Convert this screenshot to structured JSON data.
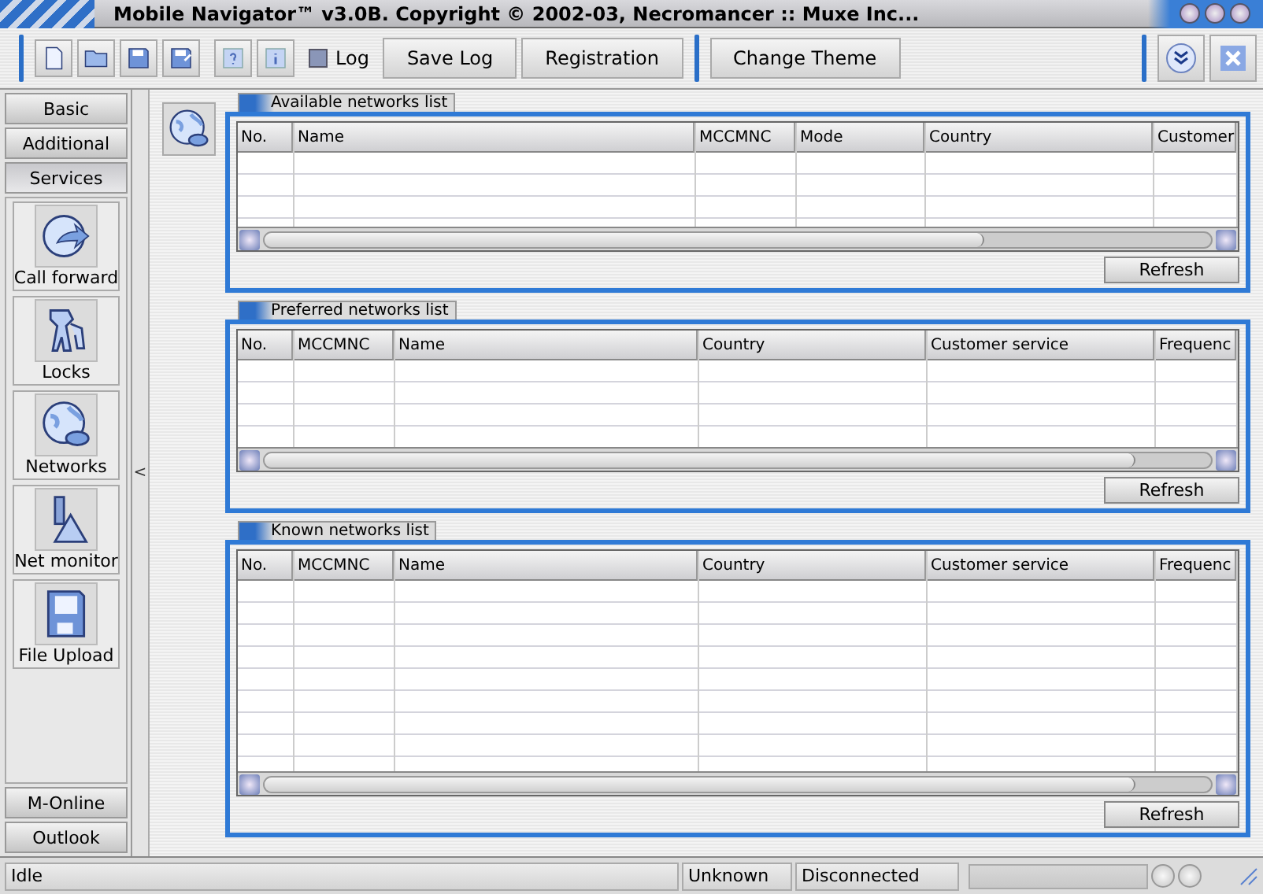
{
  "window": {
    "title": "Mobile Navigator™ v3.0B. Copyright © 2002-03, Necromancer :: Muxe Inc..."
  },
  "toolbar": {
    "icon_buttons": [
      {
        "kind": "page"
      },
      {
        "kind": "folder"
      },
      {
        "kind": "save"
      },
      {
        "kind": "saveas"
      },
      {
        "kind": "help"
      },
      {
        "kind": "info"
      }
    ],
    "log_checkbox": {
      "label": "Log",
      "checked": true
    },
    "buttons": [
      "Save Log",
      "Registration"
    ],
    "theme_button": "Change Theme"
  },
  "sidebar": {
    "top_items": [
      {
        "label": "Basic",
        "selected": false
      },
      {
        "label": "Additional",
        "selected": false
      },
      {
        "label": "Services",
        "selected": true
      }
    ],
    "tools": [
      {
        "label": "Call forward",
        "kind": "forward"
      },
      {
        "label": "Locks",
        "kind": "keys"
      },
      {
        "label": "Networks",
        "kind": "globe"
      },
      {
        "label": "Net monitor",
        "kind": "flask"
      },
      {
        "label": "File Upload",
        "kind": "floppy"
      }
    ],
    "bottom_items": [
      {
        "label": "M-Online",
        "selected": false
      },
      {
        "label": "Outlook",
        "selected": false
      }
    ],
    "collapse_glyph": "<"
  },
  "panels": [
    {
      "title": "Available networks list",
      "columns": [
        "No.",
        "Name",
        "MCCMNC",
        "Mode",
        "Country",
        "Customer"
      ],
      "button": "Refresh"
    },
    {
      "title": "Preferred networks list",
      "columns": [
        "No.",
        "MCCMNC",
        "Name",
        "Country",
        "Customer service",
        "Frequenc"
      ],
      "button": "Refresh"
    },
    {
      "title": "Known networks list",
      "columns": [
        "No.",
        "MCCMNC",
        "Name",
        "Country",
        "Customer service",
        "Frequenc"
      ],
      "button": "Refresh"
    }
  ],
  "status_bar": {
    "message": "Idle",
    "network": "Unknown",
    "connection": "Disconnected",
    "progress": {
      "level": 0
    }
  }
}
